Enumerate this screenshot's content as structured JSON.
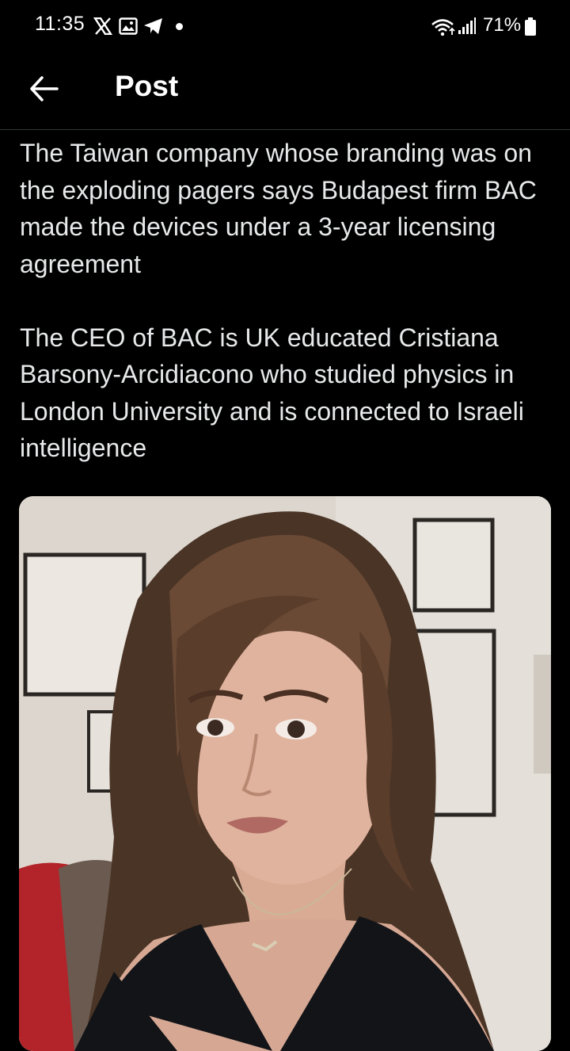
{
  "status_bar": {
    "time": "11:35",
    "battery": "71%",
    "icons": [
      "x-logo-icon",
      "image-icon",
      "telegram-icon",
      "wifi-icon",
      "signal-icon",
      "battery-icon"
    ]
  },
  "header": {
    "back_icon": "arrow-left-icon",
    "title": "Post"
  },
  "post": {
    "paragraphs": [
      "The Taiwan company whose branding was on the exploding pagers says Budapest firm BAC made the devices under a 3-year licensing agreement",
      "The CEO of BAC is UK educated Cristiana Barsony-Arcidiacono who studied physics in London University and is connected to Israeli intelligence"
    ],
    "media": {
      "type": "photo"
    }
  },
  "colors": {
    "background": "#000000",
    "text": "#e7e9ea",
    "divider": "#2f3336"
  }
}
